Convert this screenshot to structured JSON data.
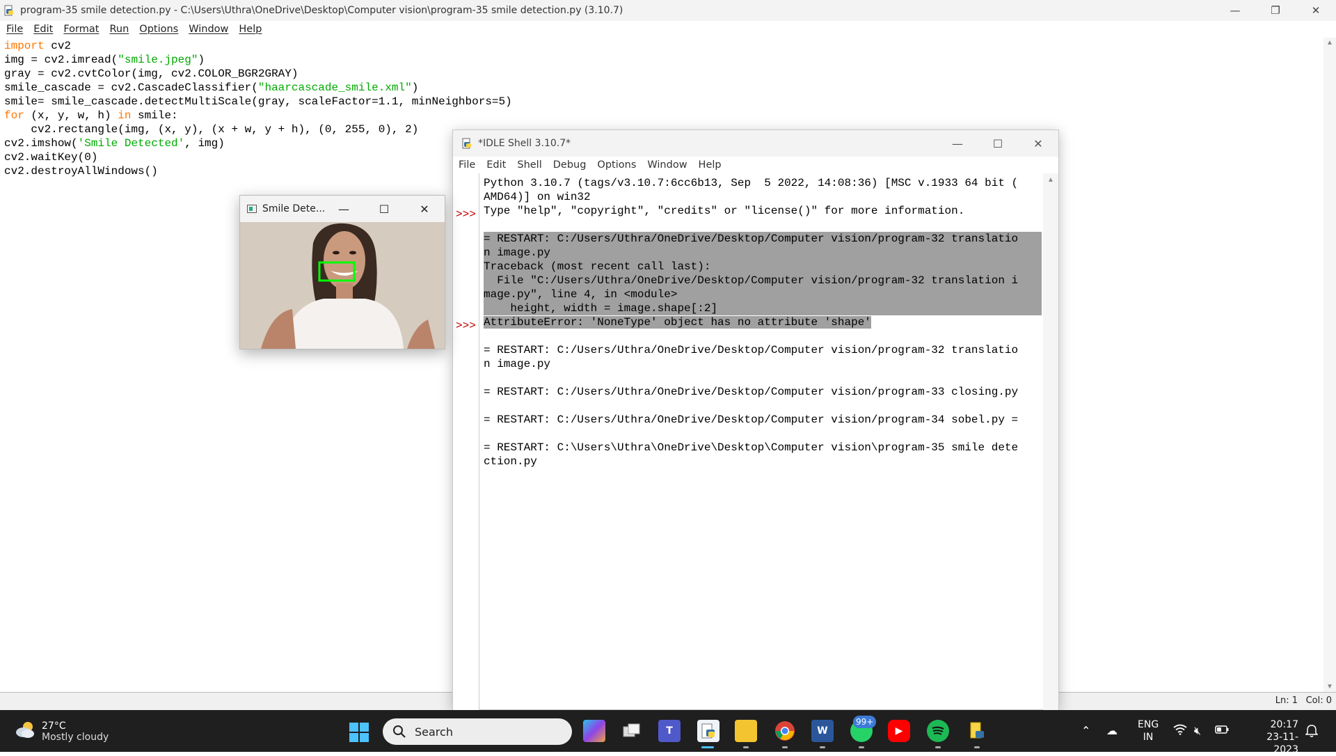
{
  "editor": {
    "title": "program-35 smile detection.py - C:\\Users\\Uthra\\OneDrive\\Desktop\\Computer vision\\program-35 smile detection.py (3.10.7)",
    "menu": [
      "File",
      "Edit",
      "Format",
      "Run",
      "Options",
      "Window",
      "Help"
    ],
    "code": {
      "l1_kw": "import",
      "l1_rest": " cv2",
      "l2_a": "img = cv2.imread(",
      "l2_s": "\"smile.jpeg\"",
      "l2_b": ")",
      "l3": "gray = cv2.cvtColor(img, cv2.COLOR_BGR2GRAY)",
      "l4_a": "smile_cascade = cv2.CascadeClassifier(",
      "l4_s": "\"haarcascade_smile.xml\"",
      "l4_b": ")",
      "l5": "smile= smile_cascade.detectMultiScale(gray, scaleFactor=1.1, minNeighbors=5)",
      "l6_kw1": "for",
      "l6_a": " (x, y, w, h) ",
      "l6_kw2": "in",
      "l6_b": " smile:",
      "l7": "    cv2.rectangle(img, (x, y), (x + w, y + h), (0, 255, 0), 2)",
      "l8_a": "cv2.imshow(",
      "l8_s": "'Smile Detected'",
      "l8_b": ", img)",
      "l9": "cv2.waitKey(0)",
      "l10": "cv2.destroyAllWindows()"
    },
    "status": {
      "line": "Ln: 1",
      "col": "Col: 0"
    }
  },
  "shell": {
    "title": "*IDLE Shell 3.10.7*",
    "menu": [
      "File",
      "Edit",
      "Shell",
      "Debug",
      "Options",
      "Window",
      "Help"
    ],
    "prompt": ">>>",
    "lines": {
      "banner1": "Python 3.10.7 (tags/v3.10.7:6cc6b13, Sep  5 2022, 14:08:36) [MSC v.1933 64 bit (",
      "banner2": "AMD64)] on win32",
      "banner3": "Type \"help\", \"copyright\", \"credits\" or \"license()\" for more information.",
      "err1": "= RESTART: C:/Users/Uthra/OneDrive/Desktop/Computer vision/program-32 translatio",
      "err2": "n image.py",
      "err3": "Traceback (most recent call last):",
      "err4": "  File \"C:/Users/Uthra/OneDrive/Desktop/Computer vision/program-32 translation i",
      "err5": "mage.py\", line 4, in <module>",
      "err6": "    height, width = image.shape[:2]",
      "err7": "AttributeError: 'NoneType' object has no attribute 'shape'",
      "r1a": "= RESTART: C:/Users/Uthra/OneDrive/Desktop/Computer vision/program-32 translatio",
      "r1b": "n image.py",
      "r2": "= RESTART: C:/Users/Uthra/OneDrive/Desktop/Computer vision/program-33 closing.py",
      "r3": "= RESTART: C:/Users/Uthra/OneDrive/Desktop/Computer vision/program-34 sobel.py =",
      "r4a": "= RESTART: C:\\Users\\Uthra\\OneDrive\\Desktop\\Computer vision\\program-35 smile dete",
      "r4b": "ction.py"
    }
  },
  "smile_window": {
    "title": "Smile Dete..."
  },
  "taskbar": {
    "weather_temp": "27°C",
    "weather_cond": "Mostly cloudy",
    "search_label": "Search",
    "whatsapp_badge": "99+",
    "lang1": "ENG",
    "lang2": "IN",
    "time": "20:17",
    "date": "23-11-2023",
    "icons": [
      "copilot-icon",
      "task-view-icon",
      "teams-icon",
      "idle-icon",
      "file-explorer-icon",
      "chrome-icon",
      "word-icon",
      "whatsapp-icon",
      "youtube-icon",
      "spotify-icon",
      "python-file-icon"
    ]
  },
  "colors": {
    "keyword": "#ff7700",
    "string": "#00aa00",
    "prompt": "#c00000",
    "selection": "#a0a0a0",
    "taskbar": "#1f1f1f",
    "accent": "#4cc2ff"
  }
}
